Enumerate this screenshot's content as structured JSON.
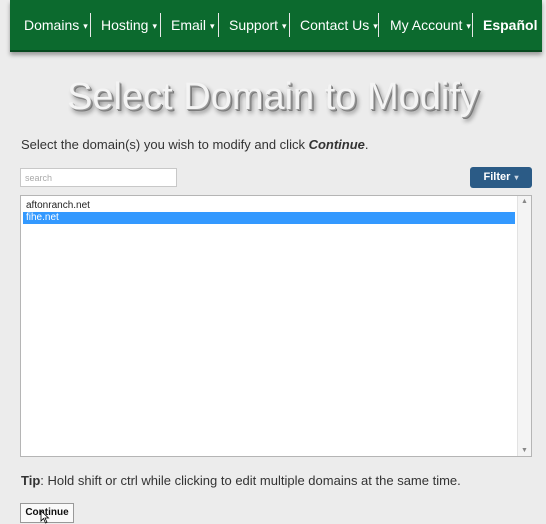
{
  "nav": {
    "items": [
      {
        "label": "Domains",
        "caret": "▾"
      },
      {
        "label": "Hosting",
        "caret": "▾"
      },
      {
        "label": "Email",
        "caret": "▾"
      },
      {
        "label": "Support",
        "caret": "▾"
      },
      {
        "label": "Contact Us",
        "caret": "▾"
      },
      {
        "label": "My Account",
        "caret": "▾"
      },
      {
        "label": "Español"
      }
    ]
  },
  "page": {
    "title": "Select Domain to Modify",
    "instructions_prefix": "Select the domain(s) you wish to modify and click ",
    "instructions_emphasis": "Continue",
    "instructions_suffix": "."
  },
  "search": {
    "placeholder": "search",
    "value": ""
  },
  "filter": {
    "label": "Filter",
    "caret": "▾"
  },
  "domains": {
    "items": [
      {
        "name": "aftonranch.net",
        "selected": false
      },
      {
        "name": "fihe.net",
        "selected": true
      }
    ]
  },
  "tip": {
    "label": "Tip",
    "text": ": Hold shift or ctrl while clicking to edit multiple domains at the same time."
  },
  "continue": {
    "label": "Continue"
  },
  "colors": {
    "nav_background": "#0c6a2e",
    "filter_button": "#2b5b86",
    "selection": "#3399ff"
  }
}
